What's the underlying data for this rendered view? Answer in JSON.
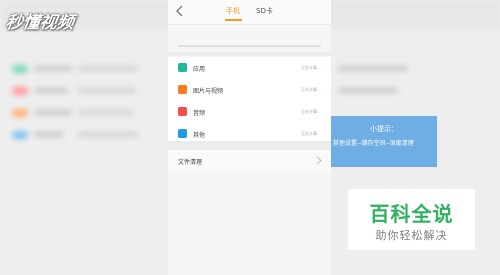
{
  "watermark_logo": {
    "text": "秒懂视频"
  },
  "header": {
    "tabs": [
      {
        "label": "手机",
        "active": true
      },
      {
        "label": "SD卡",
        "active": false
      }
    ],
    "active_color": "#f39a21"
  },
  "categories": [
    {
      "label": "应用",
      "size": "正在计算...",
      "color": "#1fb89a"
    },
    {
      "label": "图片与视频",
      "size": "正在计算...",
      "color": "#f57d1f"
    },
    {
      "label": "音频",
      "size": "正在计算...",
      "color": "#f0504a"
    },
    {
      "label": "其他",
      "size": "正在计算...",
      "color": "#1e9be6"
    }
  ],
  "file_cleanup": {
    "label": "文件清理"
  },
  "tip": {
    "title": "小提示：",
    "body": "其他设置--储存空间--深度清理",
    "bg_color": "#6faee4"
  },
  "baike": {
    "title": "百科全说",
    "subtitle": "助你轻松解决",
    "color": "#2fb15f"
  }
}
